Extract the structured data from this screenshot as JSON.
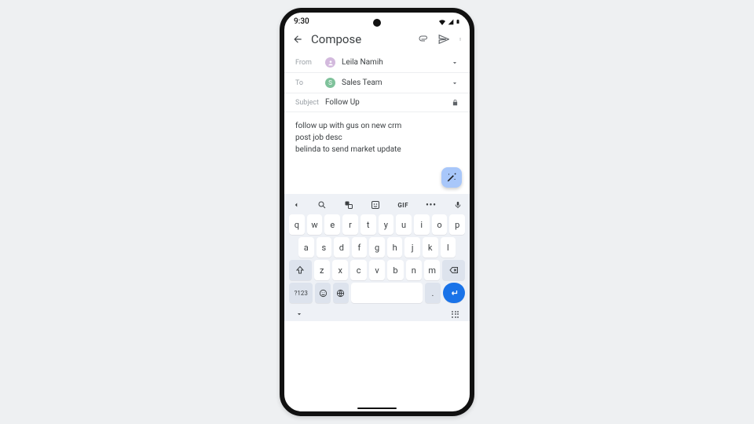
{
  "status": {
    "time": "9:30"
  },
  "appbar": {
    "title": "Compose"
  },
  "from": {
    "label": "From",
    "name": "Leila Namih"
  },
  "to": {
    "label": "To",
    "name": "Sales Team",
    "initial": "S"
  },
  "subject": {
    "label": "Subject",
    "value": "Follow Up"
  },
  "body": {
    "line1": "follow up with gus on new crm",
    "line2": "post job desc",
    "line3": "belinda to send market update"
  },
  "keyboard": {
    "gif": "GIF",
    "row1": [
      "q",
      "w",
      "e",
      "r",
      "t",
      "y",
      "u",
      "i",
      "o",
      "p"
    ],
    "row2": [
      "a",
      "s",
      "d",
      "f",
      "g",
      "h",
      "j",
      "k",
      "l"
    ],
    "row3": [
      "z",
      "x",
      "c",
      "v",
      "b",
      "n",
      "m"
    ],
    "mode": "?123",
    "comma": ",",
    "period": "."
  }
}
